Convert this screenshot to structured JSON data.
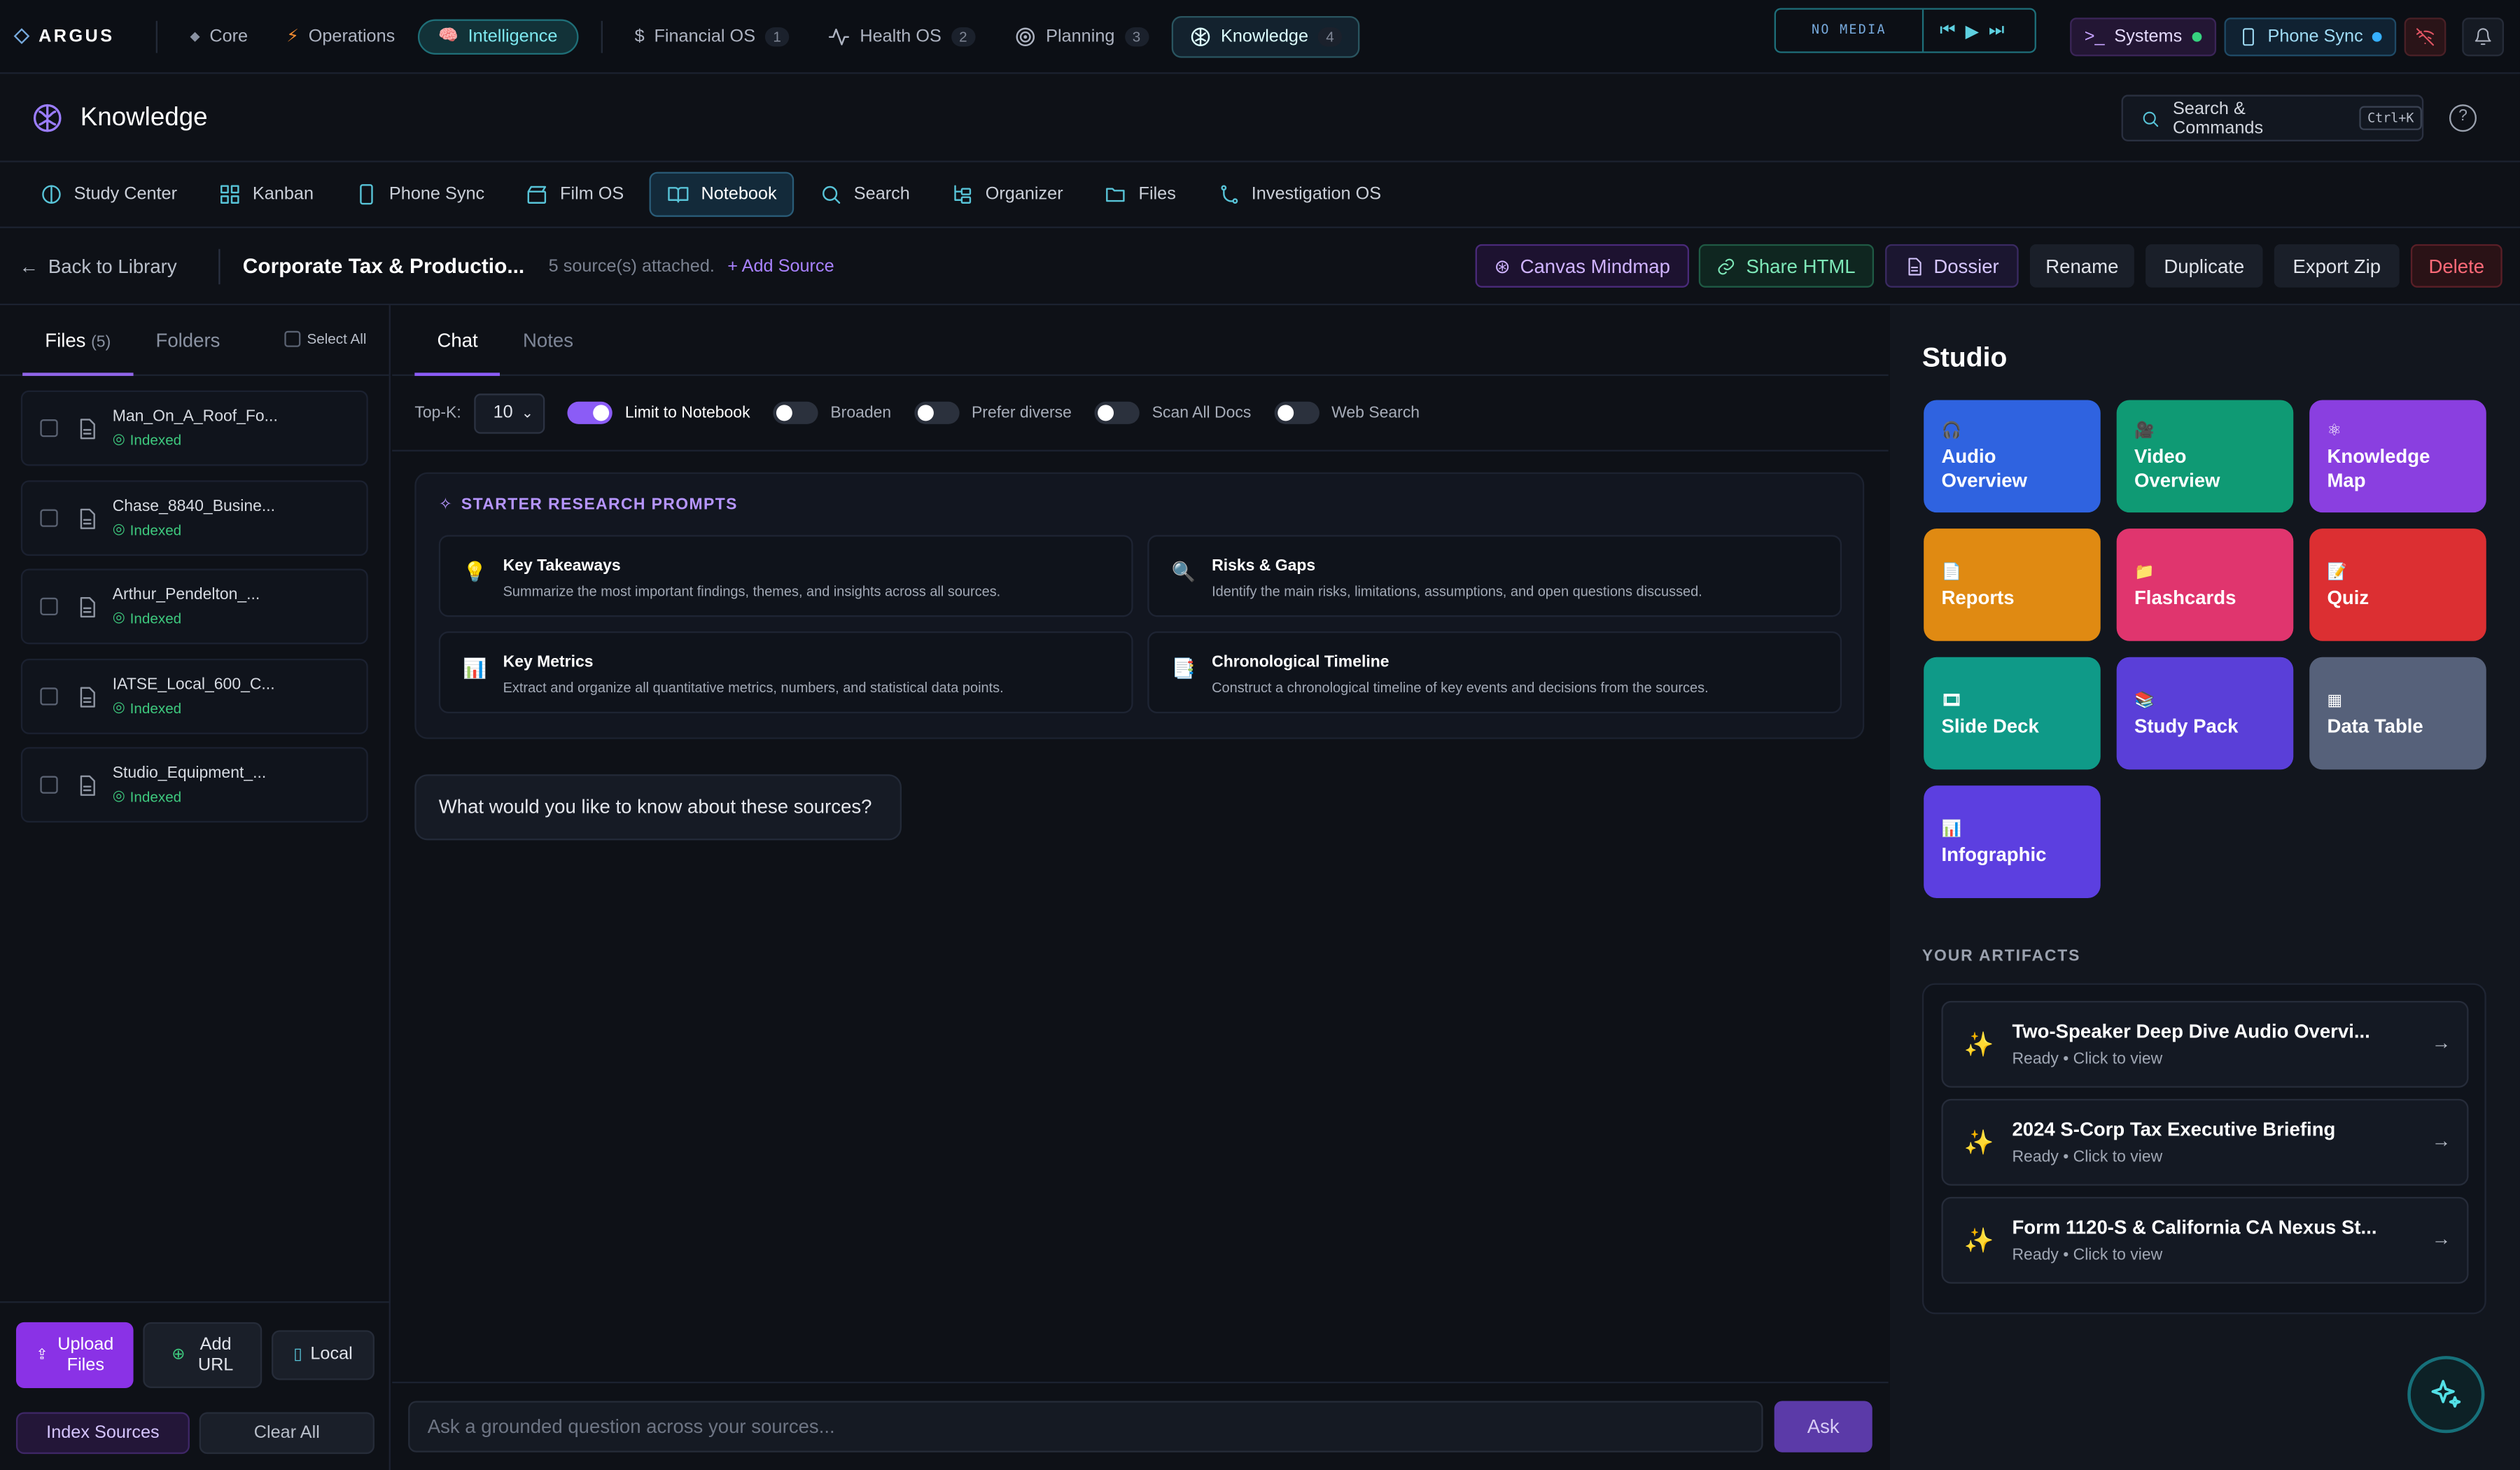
{
  "app": {
    "brand": "ARGUS"
  },
  "topnav": {
    "items": [
      {
        "label": "Core",
        "count": ""
      },
      {
        "label": "Operations",
        "count": ""
      },
      {
        "label": "Intelligence",
        "count": ""
      },
      {
        "label": "Financial OS",
        "count": "1"
      },
      {
        "label": "Health OS",
        "count": "2"
      },
      {
        "label": "Planning",
        "count": "3"
      },
      {
        "label": "Knowledge",
        "count": "4"
      }
    ],
    "media_label": "NO MEDIA",
    "systems": "Systems",
    "phone_sync": "Phone Sync"
  },
  "header": {
    "title": "Knowledge",
    "search_label": "Search & Commands",
    "search_kbd": "Ctrl+K",
    "help": "?"
  },
  "tabs": [
    "Study Center",
    "Kanban",
    "Phone Sync",
    "Film OS",
    "Notebook",
    "Search",
    "Organizer",
    "Files",
    "Investigation OS"
  ],
  "docbar": {
    "back": "Back to Library",
    "title": "Corporate Tax & Productio...",
    "sources": "5 source(s) attached.",
    "add_source": "+ Add Source",
    "buttons": {
      "mindmap": "Canvas Mindmap",
      "share": "Share HTML",
      "dossier": "Dossier",
      "rename": "Rename",
      "duplicate": "Duplicate",
      "export": "Export Zip",
      "delete": "Delete"
    }
  },
  "left": {
    "tab_files": "Files",
    "files_count": "(5)",
    "tab_folders": "Folders",
    "select_all": "Select All",
    "files": [
      {
        "name": "Man_On_A_Roof_Fo...",
        "status": "Indexed"
      },
      {
        "name": "Chase_8840_Busine...",
        "status": "Indexed"
      },
      {
        "name": "Arthur_Pendelton_...",
        "status": "Indexed"
      },
      {
        "name": "IATSE_Local_600_C...",
        "status": "Indexed"
      },
      {
        "name": "Studio_Equipment_...",
        "status": "Indexed"
      }
    ],
    "upload_1": "Upload",
    "upload_2": "Files",
    "addurl_1": "Add",
    "addurl_2": "URL",
    "local": "Local",
    "index": "Index Sources",
    "clear": "Clear All"
  },
  "center": {
    "tab_chat": "Chat",
    "tab_notes": "Notes",
    "topk_label": "Top-K:",
    "topk_value": "10",
    "toggles": [
      {
        "label": "Limit to Notebook",
        "on": true
      },
      {
        "label": "Broaden",
        "on": false
      },
      {
        "label": "Prefer diverse",
        "on": false
      },
      {
        "label": "Scan All Docs",
        "on": false
      },
      {
        "label": "Web Search",
        "on": false
      }
    ],
    "prompts_title": "STARTER RESEARCH PROMPTS",
    "prompts": [
      {
        "emoji": "💡",
        "title": "Key Takeaways",
        "desc": "Summarize the most important findings, themes, and insights across all sources."
      },
      {
        "emoji": "🔍",
        "title": "Risks & Gaps",
        "desc": "Identify the main risks, limitations, assumptions, and open questions discussed."
      },
      {
        "emoji": "📊",
        "title": "Key Metrics",
        "desc": "Extract and organize all quantitative metrics, numbers, and statistical data points."
      },
      {
        "emoji": "📑",
        "title": "Chronological Timeline",
        "desc": "Construct a chronological timeline of key events and decisions from the sources."
      }
    ],
    "assistant_message": "What would you like to know about these sources?",
    "input_placeholder": "Ask a grounded question across your sources...",
    "ask": "Ask"
  },
  "studio": {
    "title": "Studio",
    "tiles": [
      {
        "emoji": "🎧",
        "l1": "Audio",
        "l2": "Overview",
        "color": "#2f63e0"
      },
      {
        "emoji": "🎥",
        "l1": "Video",
        "l2": "Overview",
        "color": "#0f9a74"
      },
      {
        "emoji": "⚛",
        "l1": "Knowledge",
        "l2": "Map",
        "color": "#8a3fe0"
      },
      {
        "emoji": "📄",
        "l1": "Reports",
        "l2": "",
        "color": "#e08a12"
      },
      {
        "emoji": "📁",
        "l1": "Flashcards",
        "l2": "",
        "color": "#e0356e"
      },
      {
        "emoji": "📝",
        "l1": "Quiz",
        "l2": "",
        "color": "#dc2f32"
      },
      {
        "emoji": "🎞",
        "l1": "Slide Deck",
        "l2": "",
        "color": "#0f9a88"
      },
      {
        "emoji": "📚",
        "l1": "Study Pack",
        "l2": "",
        "color": "#5a3fd8"
      },
      {
        "emoji": "▦",
        "l1": "Data Table",
        "l2": "",
        "color": "#56617a"
      },
      {
        "emoji": "📊",
        "l1": "Infographic",
        "l2": "",
        "color": "#5c3fe0"
      }
    ],
    "artifacts_title": "YOUR ARTIFACTS",
    "artifacts": [
      {
        "title": "Two-Speaker Deep Dive Audio Overvi...",
        "status": "Ready • Click to view"
      },
      {
        "title": "2024 S-Corp Tax Executive Briefing",
        "status": "Ready • Click to view"
      },
      {
        "title": "Form 1120-S & California CA Nexus St...",
        "status": "Ready • Click to view"
      }
    ]
  }
}
